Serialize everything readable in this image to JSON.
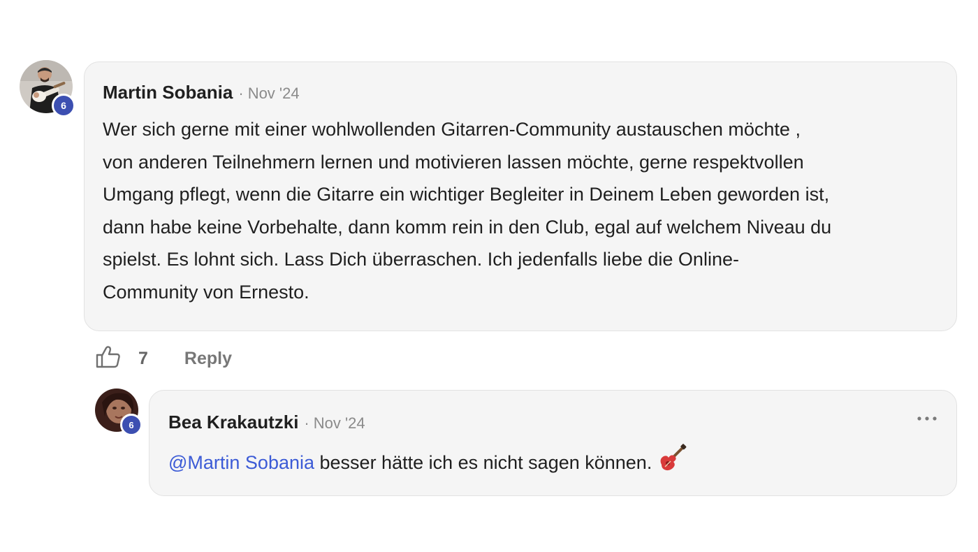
{
  "comment": {
    "author": "Martin Sobania",
    "separator": "·",
    "date": "Nov '24",
    "level": "6",
    "lines": [
      "Wer sich gerne mit einer wohlwollenden Gitarren-Community austauschen möchte ,",
      "von anderen Teilnehmern lernen und motivieren lassen möchte, gerne respektvollen",
      "Umgang pflegt, wenn die Gitarre ein wichtiger Begleiter in Deinem Leben geworden ist,",
      "dann habe keine Vorbehalte, dann komm rein in den Club, egal auf welchem Niveau du",
      "spielst. Es lohnt sich. Lass Dich überraschen. Ich jedenfalls liebe die Online-",
      "Community von Ernesto."
    ],
    "likes": "7",
    "reply_label": "Reply"
  },
  "reply": {
    "author": "Bea Krakautzki",
    "separator": "·",
    "date": "Nov '24",
    "level": "6",
    "mention": "@Martin Sobania",
    "text": " besser hätte ich es nicht sagen können. ",
    "emoji": "🎸",
    "more_label": "..."
  },
  "colors": {
    "accent": "#3c4fb1",
    "mention": "#3c5bd6",
    "bubble_bg": "#f5f5f5",
    "muted": "#8a8a8a"
  },
  "icons": {
    "like": "thumbs-up-icon",
    "more": "more-horizontal-icon"
  }
}
